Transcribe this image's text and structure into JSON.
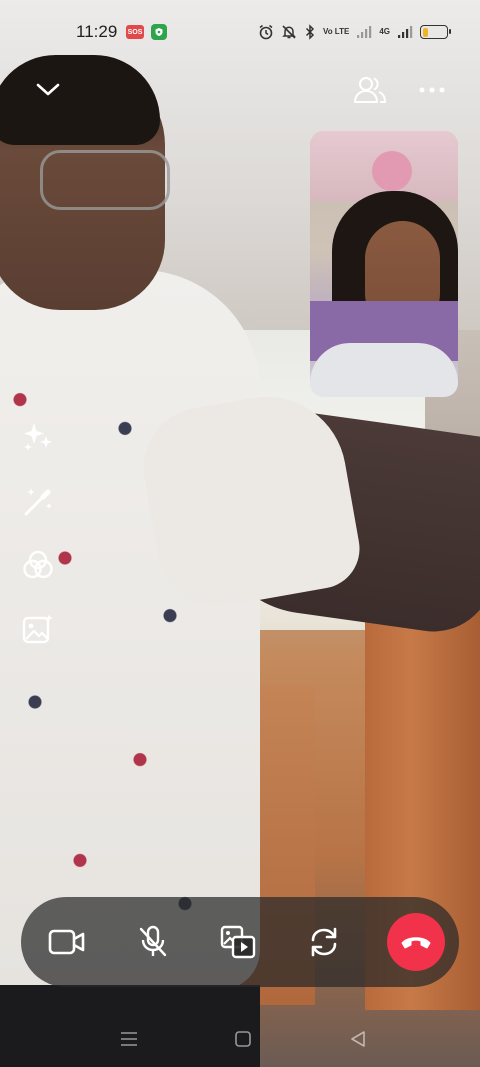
{
  "status_bar": {
    "time": "11:29",
    "sos_label": "SOS",
    "network_label": "Vo LTE",
    "signal_label": "4G",
    "battery_percent": 25,
    "battery_color": "#f0b428"
  },
  "header": {
    "collapse_icon": "chevron-down-icon",
    "participants_icon": "participants-icon",
    "more_icon": "more-dots-icon"
  },
  "effects": [
    {
      "name": "sparkles-icon"
    },
    {
      "name": "magic-wand-icon"
    },
    {
      "name": "filters-icon"
    },
    {
      "name": "background-image-icon"
    }
  ],
  "controls": [
    {
      "name": "video-icon"
    },
    {
      "name": "mic-off-icon"
    },
    {
      "name": "share-media-icon"
    },
    {
      "name": "switch-camera-icon"
    },
    {
      "name": "end-call-icon"
    }
  ],
  "colors": {
    "end_call": "#f2314a",
    "controls_bar": "#282828"
  }
}
